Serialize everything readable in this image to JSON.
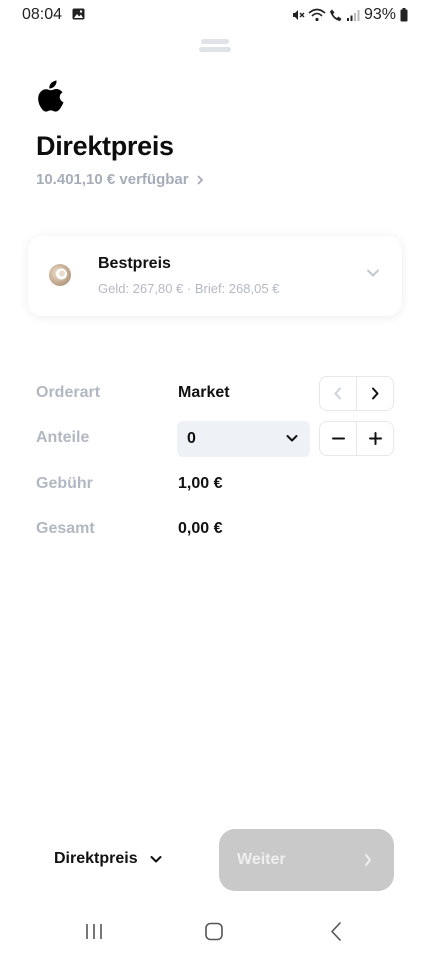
{
  "status_bar": {
    "time": "08:04",
    "battery": "93%",
    "icons": [
      "gallery-icon",
      "mute-icon",
      "wifi-icon",
      "call-icon",
      "signal-icon",
      "battery-icon"
    ]
  },
  "header": {
    "company_logo": "apple-logo-icon",
    "title": "Direktpreis",
    "available": "10.401,10 € verfügbar"
  },
  "venue_card": {
    "name": "Bestpreis",
    "quote": "Geld: 267,80 € · Brief: 268,05 €"
  },
  "order_form": {
    "order_type_label": "Orderart",
    "order_type_value": "Market",
    "shares_label": "Anteile",
    "shares_value": "0",
    "fee_label": "Gebühr",
    "fee_value": "1,00 €",
    "total_label": "Gesamt",
    "total_value": "0,00 €"
  },
  "footer": {
    "order_type_selector": "Direktpreis",
    "next_button": "Weiter"
  },
  "colors": {
    "muted_text": "#b2b8c2",
    "disabled_button": "#c9c9c9",
    "select_bg": "#eef1f6"
  }
}
